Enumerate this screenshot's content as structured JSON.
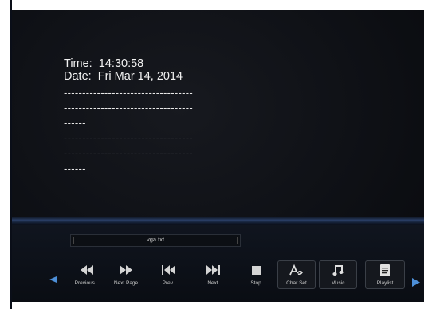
{
  "clock": {
    "time_label": "Time:",
    "time_value": "14:30:58",
    "date_label": "Date:",
    "date_value": "Fri Mar 14, 2014"
  },
  "text_lines": [
    "-----------------------------------",
    "-----------------------------------",
    "------",
    "-----------------------------------",
    "-----------------------------------",
    "------"
  ],
  "file": {
    "name": "vga.txt"
  },
  "controls": {
    "previous_page": "Previous...",
    "next_page": "Next Page",
    "prev": "Prev.",
    "next": "Next",
    "stop": "Stop",
    "char_set": "Char Set",
    "music": "Music",
    "playlist": "Playlist"
  },
  "colors": {
    "accent_blue": "#4d8fd8",
    "divider_blue": "#2a3f66"
  }
}
